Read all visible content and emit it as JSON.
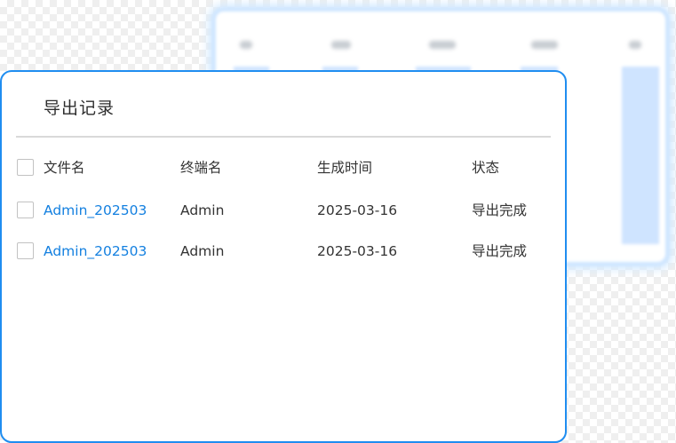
{
  "panel": {
    "title": "导出记录",
    "columns": [
      "文件名",
      "终端名",
      "生成时间",
      "状态"
    ],
    "rows": [
      {
        "filename": "Admin_202503",
        "terminal": "Admin",
        "time": "2025-03-16",
        "status": "导出完成"
      },
      {
        "filename": "Admin_202503",
        "terminal": "Admin",
        "time": "2025-03-16",
        "status": "导出完成"
      }
    ]
  },
  "colors": {
    "accent": "#1f8df0",
    "link": "#1480e0",
    "rear_card_glow": "#cfe6ff"
  }
}
